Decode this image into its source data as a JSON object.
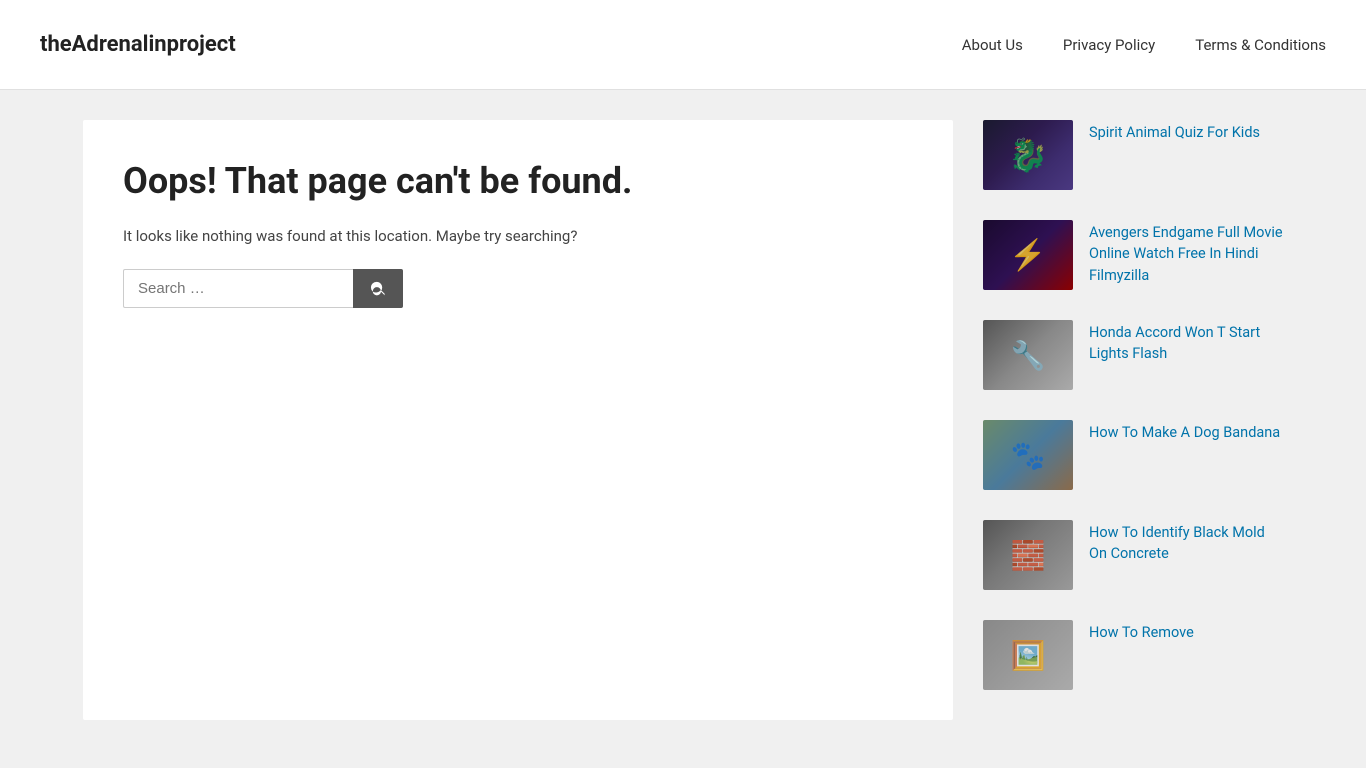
{
  "header": {
    "site_title": "theAdrenalinproject",
    "nav": [
      {
        "label": "About Us",
        "url": "#"
      },
      {
        "label": "Privacy Policy",
        "url": "#"
      },
      {
        "label": "Terms & Conditions",
        "url": "#"
      }
    ]
  },
  "main": {
    "error_title": "Oops! That page can't be found.",
    "error_description": "It looks like nothing was found at this location. Maybe try searching?",
    "search_placeholder": "Search …"
  },
  "sidebar": {
    "items": [
      {
        "id": "spirit-animal",
        "thumb_class": "thumb-spirit",
        "link_text": "Spirit Animal Quiz For Kids",
        "url": "#"
      },
      {
        "id": "avengers",
        "thumb_class": "thumb-avengers",
        "link_text": "Avengers Endgame Full Movie Online Watch Free In Hindi Filmyzilla",
        "url": "#"
      },
      {
        "id": "honda",
        "thumb_class": "thumb-honda",
        "link_text": "Honda Accord Won T Start Lights Flash",
        "url": "#"
      },
      {
        "id": "dog-bandana",
        "thumb_class": "thumb-dog",
        "link_text": "How To Make A Dog Bandana",
        "url": "#"
      },
      {
        "id": "black-mold",
        "thumb_class": "thumb-mold",
        "link_text": "How To Identify Black Mold On Concrete",
        "url": "#"
      },
      {
        "id": "how-remove",
        "thumb_class": "thumb-remove",
        "link_text": "How To Remove",
        "url": "#"
      }
    ]
  }
}
